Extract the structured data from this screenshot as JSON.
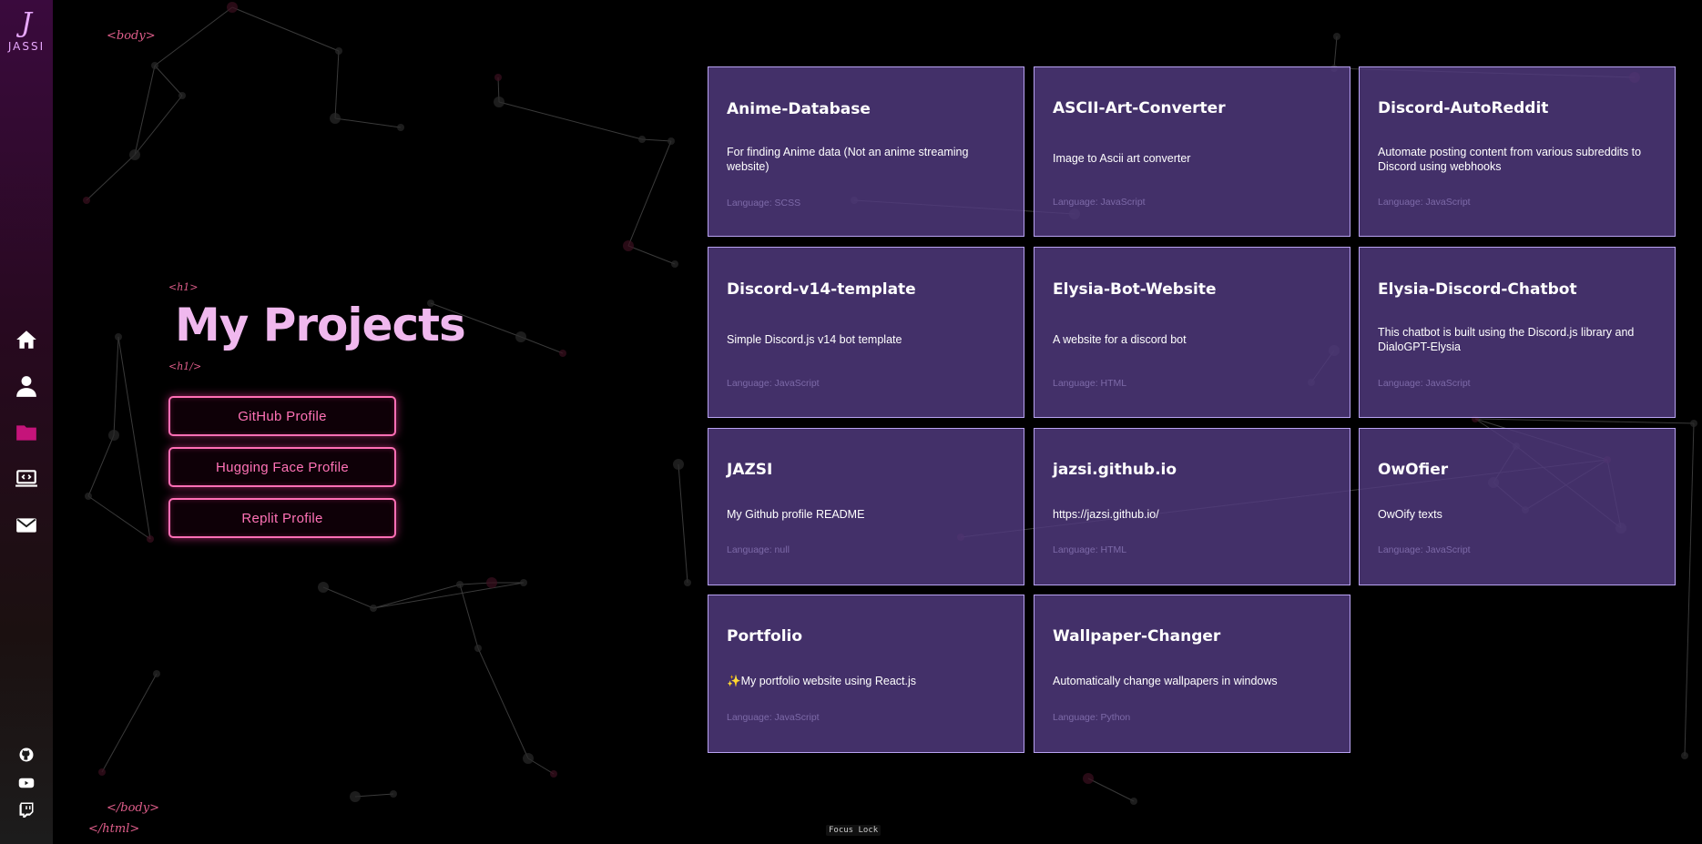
{
  "brand": {
    "mark": "J",
    "name": "JASSI"
  },
  "nav": [
    {
      "icon": "home-icon",
      "label": "Home"
    },
    {
      "icon": "user-icon",
      "label": "About"
    },
    {
      "icon": "folder-icon",
      "label": "Projects"
    },
    {
      "icon": "laptop-code-icon",
      "label": "Skills"
    },
    {
      "icon": "envelope-icon",
      "label": "Contact"
    }
  ],
  "social": [
    {
      "icon": "github-icon"
    },
    {
      "icon": "youtube-icon"
    },
    {
      "icon": "twitch-icon"
    }
  ],
  "code_tags": {
    "body_open": "<body>",
    "h1_open": "<h1>",
    "h1_close": "<h1/>",
    "body_close": "</body>",
    "html_close": "</html>"
  },
  "hero": {
    "title": "My Projects",
    "buttons": [
      "GitHub Profile",
      "Hugging Face Profile",
      "Replit Profile"
    ]
  },
  "projects": [
    {
      "name": "Anime-Database",
      "description": "For finding Anime data (Not an anime streaming website)",
      "language": "Language: SCSS"
    },
    {
      "name": "ASCII-Art-Converter",
      "description": "Image to Ascii art converter",
      "language": "Language: JavaScript"
    },
    {
      "name": "Discord-AutoReddit",
      "description": "Automate posting content from various subreddits to Discord using webhooks",
      "language": "Language: JavaScript"
    },
    {
      "name": "Discord-v14-template",
      "description": "Simple Discord.js v14 bot template",
      "language": "Language: JavaScript"
    },
    {
      "name": "Elysia-Bot-Website",
      "description": "A website for a discord bot",
      "language": "Language: HTML"
    },
    {
      "name": "Elysia-Discord-Chatbot",
      "description": "This chatbot is built using the Discord.js library and DialoGPT-Elysia",
      "language": "Language: JavaScript"
    },
    {
      "name": "JAZSI",
      "description": "My Github profile README",
      "language": "Language: null"
    },
    {
      "name": "jazsi.github.io",
      "description": "https://jazsi.github.io/",
      "language": "Language: HTML"
    },
    {
      "name": "OwOfier",
      "description": "OwOify texts",
      "language": "Language: JavaScript"
    },
    {
      "name": "Portfolio",
      "description": "✨My portfolio website using React.js",
      "language": "Language: JavaScript"
    },
    {
      "name": "Wallpaper-Changer",
      "description": "Automatically change wallpapers in windows",
      "language": "Language: Python"
    }
  ],
  "focus_lock": "Focus Lock",
  "colors": {
    "accent_pink": "#ff6fb5",
    "title_pink": "#f0b8ee",
    "card_bg": "#523a80",
    "card_border": "#b9a3f2",
    "tag_red": "#e05e8b"
  }
}
